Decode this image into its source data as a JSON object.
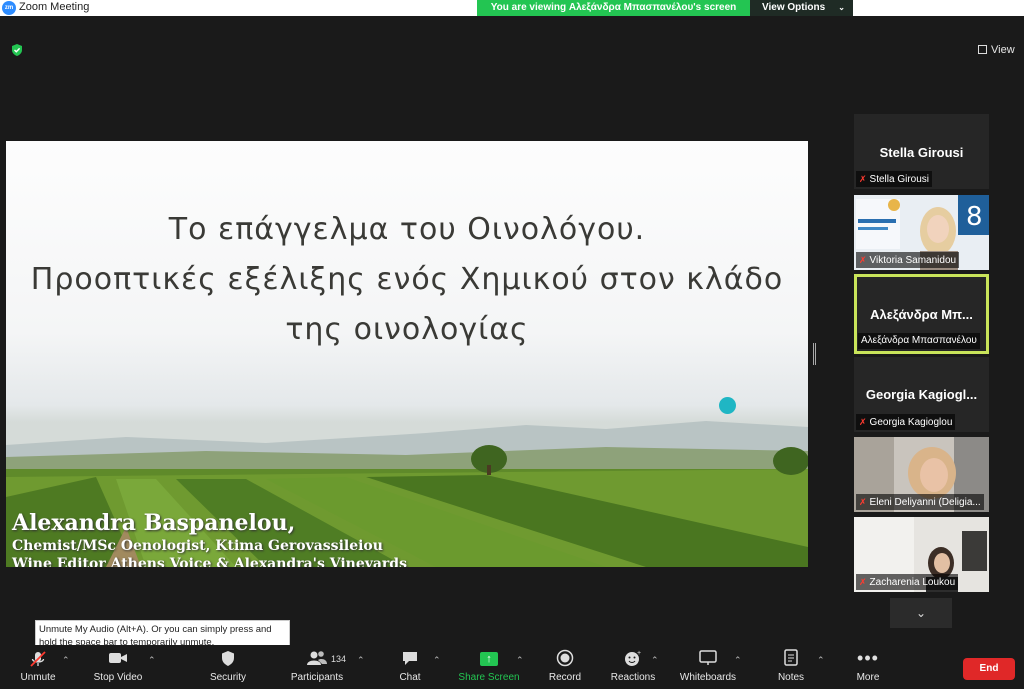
{
  "app": {
    "logo_text": "zm",
    "title": "Zoom Meeting"
  },
  "banner": {
    "viewing_text": "You are viewing Αλεξάνδρα Μπασπανέλου's screen",
    "view_options_label": "View Options"
  },
  "view_button_label": "View",
  "slide": {
    "title_lines": [
      "Το επάγγελμα του Οινολόγου.",
      "Προοπτικές εξέλιξης ενός Χημικού στον κλάδο",
      "της οινολογίας"
    ],
    "author_name": "Alexandra Baspanelou,",
    "author_role": "Chemist/MSc Oenologist, Ktima Gerovassileiou",
    "author_role_2": "Wine Editor Athens Voice & Alexandra's Vineyards"
  },
  "participants": [
    {
      "big_name": "Stella Girousi",
      "label": "Stella Girousi",
      "muted": true
    },
    {
      "big_name": "",
      "label": "Viktoria Samanidou",
      "muted": true
    },
    {
      "big_name": "Αλεξάνδρα Μπ...",
      "label": "Αλεξάνδρα Μπασπανέλου",
      "muted": false
    },
    {
      "big_name": "Georgia Kagiogl...",
      "label": "Georgia Kagioglou",
      "muted": true
    },
    {
      "big_name": "",
      "label": "Eleni Deliyanni (Deligia...",
      "muted": true
    },
    {
      "big_name": "",
      "label": "Zacharenia Loukou",
      "muted": true
    }
  ],
  "tooltip": "Unmute My Audio (Alt+A). Or you can simply press and hold the space bar to temporarily unmute.",
  "toolbar": {
    "unmute": "Unmute",
    "stop_video": "Stop Video",
    "security": "Security",
    "participants": "Participants",
    "participants_count": "134",
    "chat": "Chat",
    "share_screen": "Share Screen",
    "record": "Record",
    "reactions": "Reactions",
    "whiteboards": "Whiteboards",
    "notes": "Notes",
    "more": "More",
    "end": "End"
  },
  "colors": {
    "banner_green": "#23c552",
    "end_red": "#e02828",
    "active_border": "#c9e45a",
    "zoom_blue": "#2D8CFF"
  },
  "icons": [
    "shield-check-icon",
    "grid-icon",
    "microphone-muted-icon",
    "video-camera-icon",
    "shield-icon",
    "people-icon",
    "chat-bubble-icon",
    "share-arrow-icon",
    "record-icon",
    "emoji-icon",
    "whiteboard-icon",
    "notes-icon",
    "ellipsis-icon",
    "chevron-down-icon"
  ]
}
